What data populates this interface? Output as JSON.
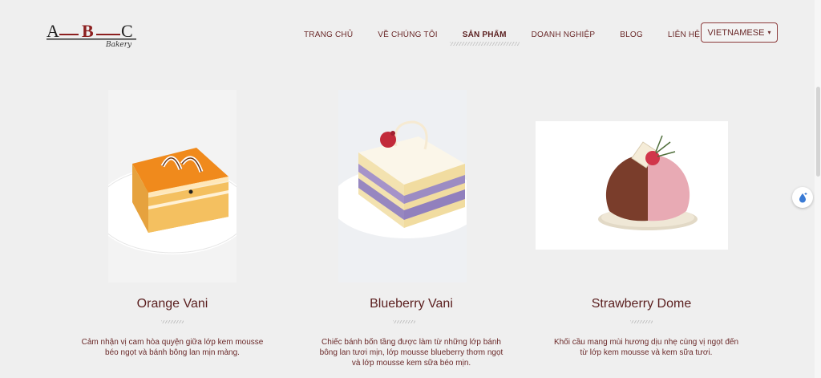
{
  "brand": {
    "logo_letters": [
      "A",
      "B",
      "C"
    ],
    "logo_tagline": "Bakery"
  },
  "nav": {
    "items": [
      "TRANG CHỦ",
      "VỀ CHÚNG TÔI",
      "SẢN PHẨM",
      "DOANH NGHIỆP",
      "BLOG",
      "LIÊN HỆ"
    ],
    "active": "SẢN PHẨM",
    "language": "VIETNAMESE",
    "language_caret": "▾"
  },
  "products": [
    {
      "name": "Orange Vani",
      "desc_lines": [
        "Cảm nhận vị cam hòa quyện giữa lớp kem mousse",
        "béo ngọt và bánh bông lan mịn màng."
      ],
      "icon": "orange-vanilla-cake-image"
    },
    {
      "name": "Blueberry Vani",
      "desc_lines": [
        "Chiếc bánh bốn tầng được làm từ những lớp bánh",
        "bông lan tươi mịn, lớp mousse blueberry thơm ngọt",
        "và lớp mousse kem sữa béo mịn."
      ],
      "icon": "blueberry-vanilla-cake-image"
    },
    {
      "name": "Strawberry Dome",
      "desc_lines": [
        "Khối cầu mang mùi hương dịu nhẹ cùng vị ngọt đến",
        "từ lớp kem mousse và kem sữa tươi."
      ],
      "icon": "strawberry-dome-cake-image"
    }
  ],
  "colors": {
    "brand": "#6b2a2a",
    "background": "#efefef"
  }
}
